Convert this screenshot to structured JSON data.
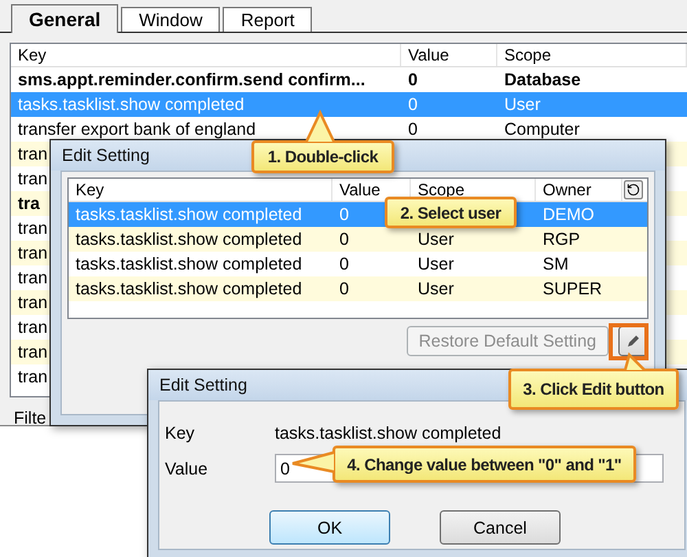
{
  "tabs": [
    {
      "label": "General",
      "selected": true
    },
    {
      "label": "Window",
      "selected": false
    },
    {
      "label": "Report",
      "selected": false
    }
  ],
  "settings_table": {
    "columns": [
      "Key",
      "Value",
      "Scope"
    ],
    "rows": [
      {
        "key": "sms.appt.reminder.confirm.send confirm...",
        "value": "0",
        "scope": "Database",
        "bold": true,
        "selected": false
      },
      {
        "key": "tasks.tasklist.show completed",
        "value": "0",
        "scope": "User",
        "bold": false,
        "selected": true
      },
      {
        "key": "transfer export bank of england",
        "value": "0",
        "scope": "Computer",
        "bold": false,
        "selected": false
      },
      {
        "key": "tran",
        "bold": false,
        "selected": false
      },
      {
        "key": "tran",
        "bold": false,
        "selected": false
      },
      {
        "key": "tra",
        "bold": true,
        "selected": false
      },
      {
        "key": "tran",
        "bold": false,
        "selected": false
      },
      {
        "key": "tran",
        "bold": false,
        "selected": false
      },
      {
        "key": "tran",
        "bold": false,
        "selected": false
      },
      {
        "key": "tran",
        "bold": false,
        "selected": false
      },
      {
        "key": "tran",
        "bold": false,
        "selected": false
      },
      {
        "key": "tran",
        "bold": false,
        "selected": false
      },
      {
        "key": "tran",
        "bold": false,
        "selected": false
      }
    ]
  },
  "filter_label": "Filte",
  "edit_setting_dialog": {
    "title": "Edit Setting",
    "columns": [
      "Key",
      "Value",
      "Scope",
      "Owner"
    ],
    "rows": [
      {
        "key": "tasks.tasklist.show completed",
        "value": "0",
        "owner": "DEMO",
        "selected": true
      },
      {
        "key": "tasks.tasklist.show completed",
        "value": "0",
        "scope": "User",
        "owner": "RGP",
        "selected": false
      },
      {
        "key": "tasks.tasklist.show completed",
        "value": "0",
        "scope": "User",
        "owner": "SM",
        "selected": false
      },
      {
        "key": "tasks.tasklist.show completed",
        "value": "0",
        "scope": "User",
        "owner": "SUPER",
        "selected": false
      }
    ],
    "restore_button": {
      "label": "Restore Default Setting",
      "disabled": true
    }
  },
  "edit_value_dialog": {
    "title": "Edit Setting",
    "key_label": "Key",
    "key_value": "tasks.tasklist.show completed",
    "value_label": "Value",
    "value": "0",
    "ok_button": "OK",
    "cancel_button": "Cancel"
  },
  "callouts": [
    {
      "text": "1. Double-click"
    },
    {
      "text": "2. Select user"
    },
    {
      "text": "3. Click Edit button"
    },
    {
      "text": "4. Change value between \"0\" and \"1\""
    }
  ]
}
